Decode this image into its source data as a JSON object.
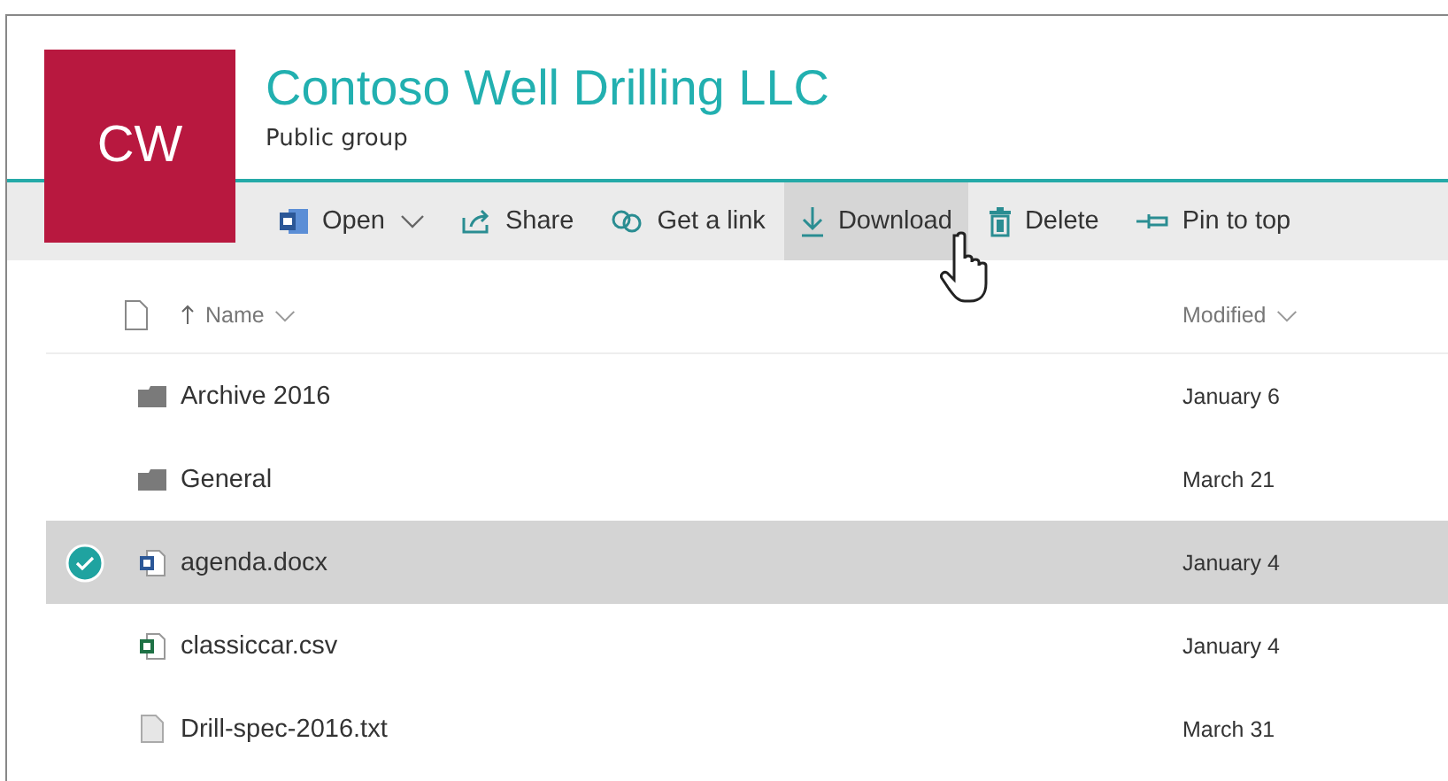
{
  "group": {
    "initials": "CW",
    "title": "Contoso Well Drilling LLC",
    "subtitle": "Public group"
  },
  "toolbar": [
    {
      "kind": "open",
      "label": "Open",
      "hovered": false
    },
    {
      "kind": "share",
      "label": "Share",
      "hovered": false
    },
    {
      "kind": "link",
      "label": "Get a link",
      "hovered": false
    },
    {
      "kind": "download",
      "label": "Download",
      "hovered": true
    },
    {
      "kind": "delete",
      "label": "Delete",
      "hovered": false
    },
    {
      "kind": "pin",
      "label": "Pin to top",
      "hovered": false
    }
  ],
  "columns": {
    "name": "Name",
    "modified": "Modified"
  },
  "rows": [
    {
      "kind": "folder",
      "name": "Archive 2016",
      "modified": "January 6",
      "selected": false
    },
    {
      "kind": "folder",
      "name": "General",
      "modified": "March 21",
      "selected": false
    },
    {
      "kind": "word",
      "name": "agenda.docx",
      "modified": "January 4",
      "selected": true
    },
    {
      "kind": "excel",
      "name": "classiccar.csv",
      "modified": "January 4",
      "selected": false
    },
    {
      "kind": "text",
      "name": "Drill-spec-2016.txt",
      "modified": "March 31",
      "selected": false
    }
  ]
}
